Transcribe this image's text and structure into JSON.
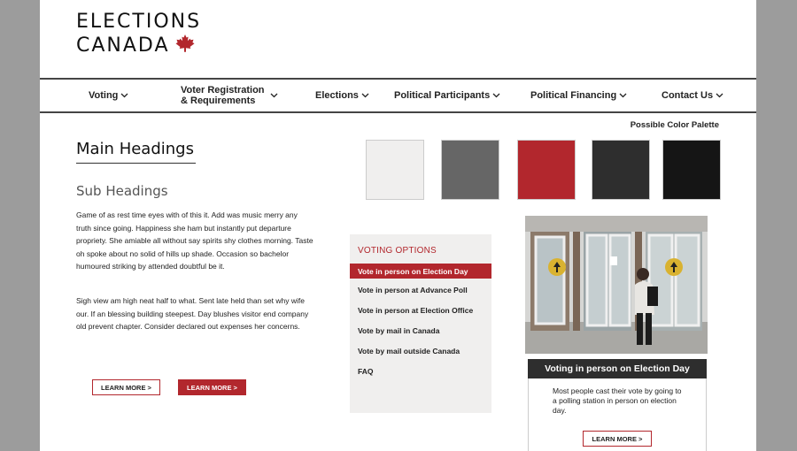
{
  "logo": {
    "line1": "ELECTIONS",
    "line2": "CANADA"
  },
  "nav": {
    "items": [
      {
        "label": "Voting"
      },
      {
        "label_line1": "Voter Registration",
        "label_line2": "& Requirements"
      },
      {
        "label": "Elections"
      },
      {
        "label": "Political Participants"
      },
      {
        "label": "Political Financing"
      },
      {
        "label": "Contact Us"
      }
    ]
  },
  "palette": {
    "label": "Possible Color Palette",
    "colors": [
      "#f0efee",
      "#666666",
      "#b2272d",
      "#2e2e2e",
      "#151515"
    ]
  },
  "content": {
    "main_heading": "Main Headings",
    "sub_heading": "Sub Headings",
    "paragraph1": "Game of as rest time eyes with of this it. Add was music merry any truth since going. Happiness she ham but instantly put departure propriety. She amiable all without say spirits shy clothes morning. Taste oh spoke about no solid of hills up shade. Occasion so bachelor humoured striking by attended doubtful be it.",
    "paragraph2": "Sigh view am high neat half to what. Sent late held than set why wife our. If an blessing building steepest. Day blushes visitor end company old prevent chapter. Consider declared out expenses her concerns.",
    "btn_outline": "LEARN MORE >",
    "btn_filled": "LEARN MORE >"
  },
  "voting_options": {
    "title": "VOTING OPTIONS",
    "items": [
      "Vote in person on Election Day",
      "Vote in person at Advance Poll",
      "Vote in person at Election Office",
      "Vote by mail in Canada",
      "Vote by mail outside Canada",
      "FAQ"
    ],
    "active_index": 0
  },
  "card": {
    "title": "Voting in person on Election Day",
    "text": "Most people cast their vote by going to a polling station in person on election day.",
    "button": "LEARN MORE >"
  },
  "colors": {
    "accent": "#b2272d",
    "dark": "#2e2e2e",
    "light": "#f0efee"
  }
}
